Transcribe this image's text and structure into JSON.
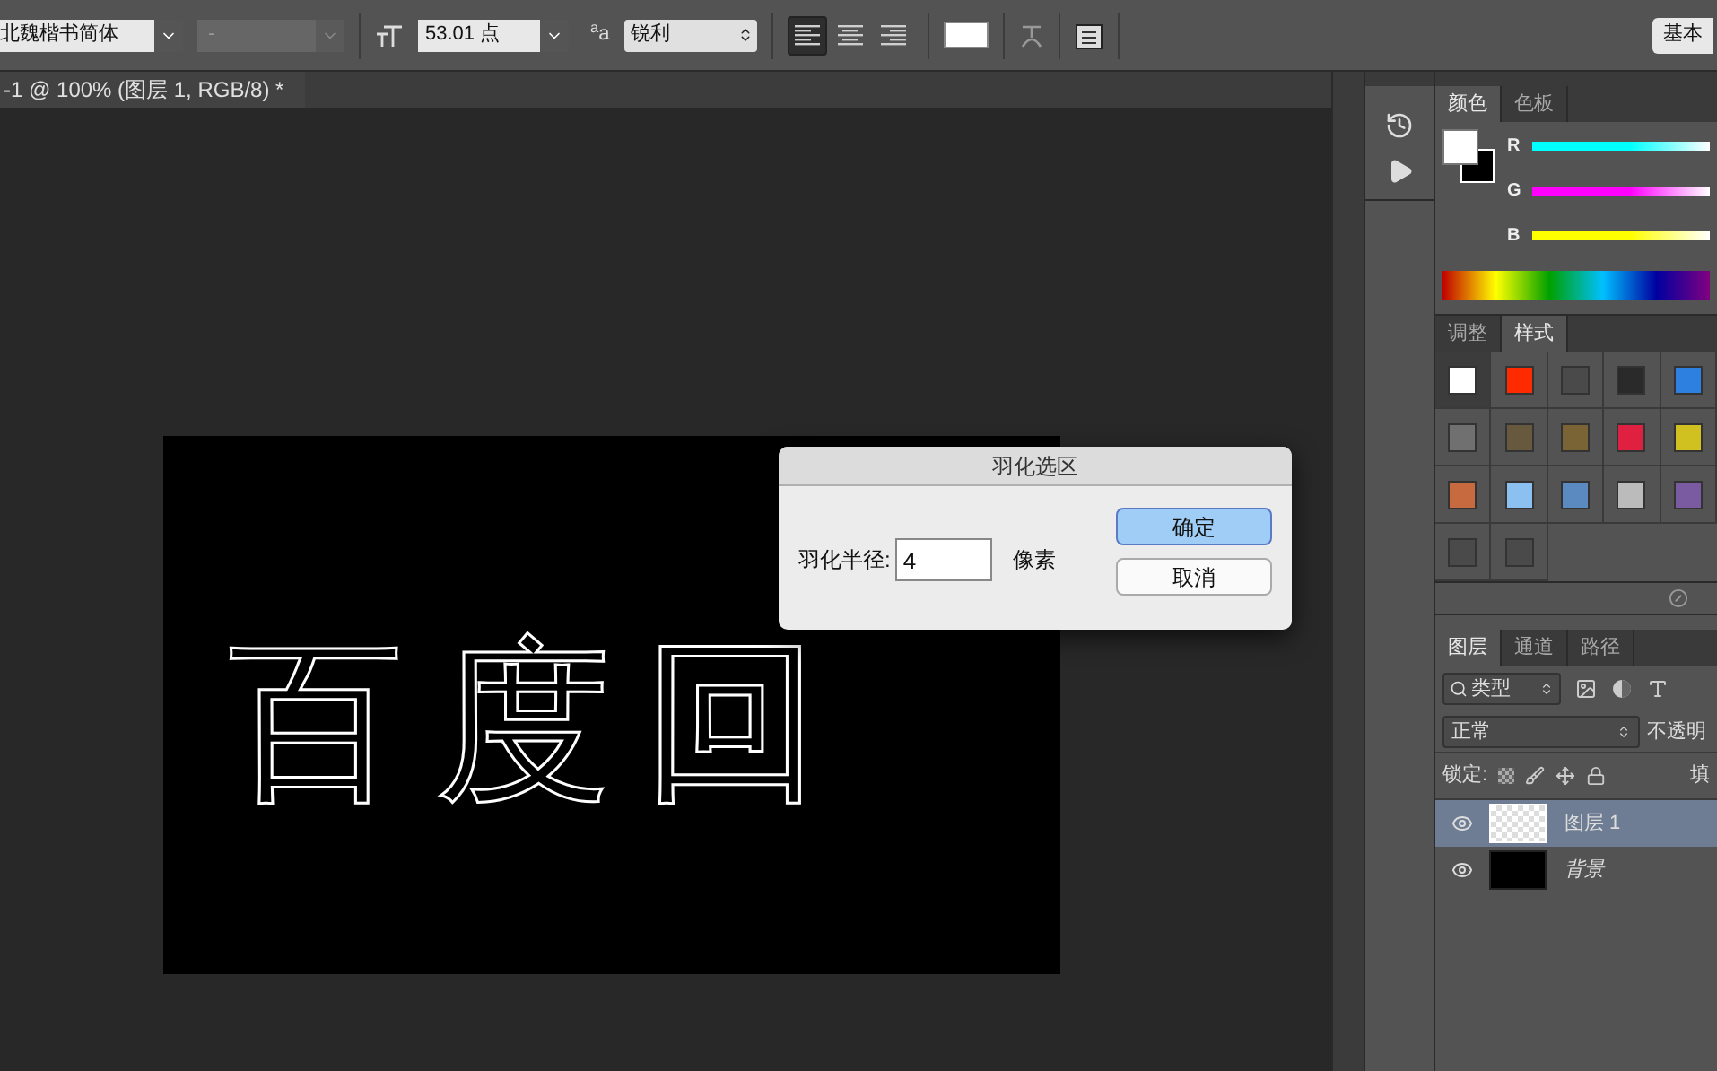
{
  "options_bar": {
    "font_family": "北魏楷书简体",
    "font_style": "-",
    "font_size": "53.01 点",
    "antialias_icon": "a",
    "antialias_icon_sub": "a",
    "antialias": "锐利",
    "align": [
      {
        "kind": "left",
        "selected": true
      },
      {
        "kind": "center",
        "selected": false
      },
      {
        "kind": "right",
        "selected": false
      }
    ],
    "workspace": "基本"
  },
  "document": {
    "tab": "-1 @ 100% (图层 1, RGB/8) *",
    "selection_text": "百度回"
  },
  "dialog": {
    "title": "羽化选区",
    "label": "羽化半径:",
    "value": "4",
    "unit": "像素",
    "buttons": [
      {
        "label": "确定",
        "default": true
      },
      {
        "label": "取消",
        "default": false
      }
    ]
  },
  "color_panel": {
    "tabs": [
      {
        "label": "颜色",
        "selected": true
      },
      {
        "label": "色板",
        "selected": false
      }
    ],
    "channels": [
      {
        "label": "R",
        "color": "#00ffff"
      },
      {
        "label": "G",
        "color": "#ff00ff"
      },
      {
        "label": "B",
        "color": "#ffff00"
      }
    ]
  },
  "styles_panel": {
    "tabs": [
      {
        "label": "调整",
        "selected": false
      },
      {
        "label": "样式",
        "selected": true
      }
    ],
    "styles": [
      {
        "color": "#ffffff",
        "selected": true
      },
      {
        "color": "#ff2a00",
        "selected": false
      },
      {
        "color": "#4a4a4a",
        "selected": false
      },
      {
        "color": "#2a2a2a",
        "selected": false
      },
      {
        "color": "#2d7fe0",
        "selected": false
      },
      {
        "color": "#707070",
        "selected": false
      },
      {
        "color": "#66593d",
        "selected": false
      },
      {
        "color": "#7a6435",
        "selected": false
      },
      {
        "color": "#e02040",
        "selected": false
      },
      {
        "color": "#d0c020",
        "selected": false
      },
      {
        "color": "#c86a40",
        "selected": false
      },
      {
        "color": "#8cc0f0",
        "selected": false
      },
      {
        "color": "#5a8ac0",
        "selected": false
      },
      {
        "color": "#bbbbbb",
        "selected": false
      },
      {
        "color": "#7a5aa0",
        "selected": false
      },
      {
        "color": "#4a4a4a",
        "selected": false
      },
      {
        "color": "#4a4a4a",
        "selected": false
      }
    ]
  },
  "layers_panel": {
    "tabs": [
      {
        "label": "图层",
        "selected": true
      },
      {
        "label": "通道",
        "selected": false
      },
      {
        "label": "路径",
        "selected": false
      }
    ],
    "filter": "类型",
    "blend_mode": "正常",
    "opacity_label": "不透明",
    "lock_label": "锁定:",
    "fill_label": "填",
    "layers": [
      {
        "name": "图层 1",
        "selected": true,
        "visible": true,
        "kind": "transparent"
      },
      {
        "name": "背景",
        "selected": false,
        "visible": true,
        "kind": "black"
      }
    ]
  }
}
